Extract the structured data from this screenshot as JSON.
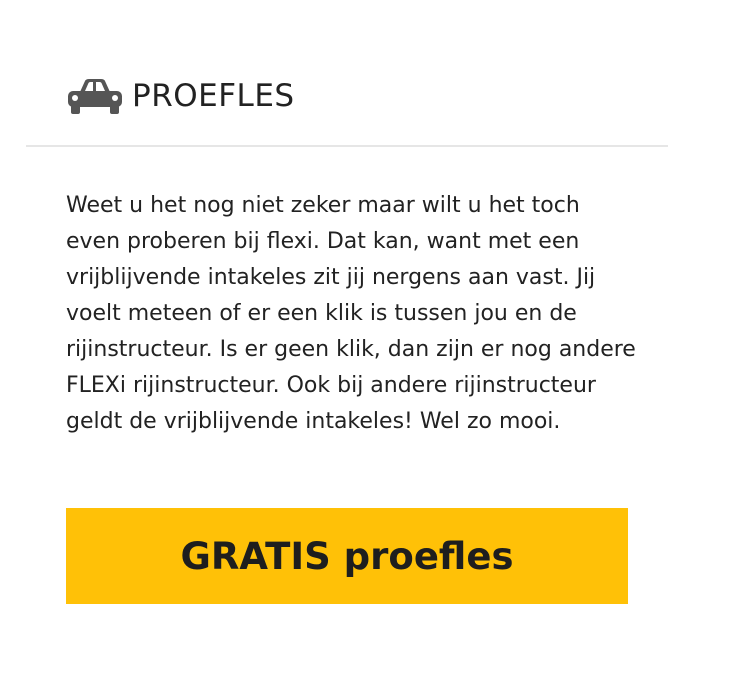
{
  "header": {
    "icon": "car-icon",
    "title": "PROEFLES"
  },
  "content": {
    "paragraph": "Weet u het nog niet zeker maar wilt u het toch even proberen bij flexi. Dat kan, want met een vrijblijvende intakeles zit jij nergens aan vast. Jij voelt meteen of er een klik is tussen jou en de rijinstructeur. Is er geen klik, dan zijn er nog andere FLEXi rijinstructeur. Ook bij andere rijinstructeur geldt de vrijblijvende intakeles! Wel zo mooi."
  },
  "cta": {
    "label": "GRATIS proefles"
  },
  "colors": {
    "accent": "#ffc107",
    "text": "#222222",
    "icon": "#555555",
    "divider": "#e6e6e6"
  }
}
